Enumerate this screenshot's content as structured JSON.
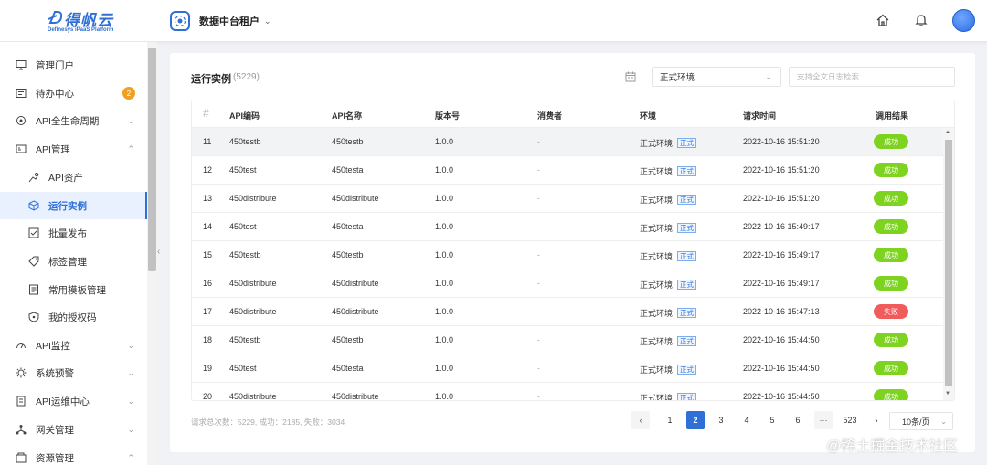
{
  "header": {
    "logo_text": "得帆云",
    "logo_sub": "Definesys iPaaS Platform",
    "tenant": "数据中台租户"
  },
  "sidebar": {
    "items": [
      {
        "label": "管理门户",
        "icon": "monitor-icon"
      },
      {
        "label": "待办中心",
        "icon": "todo-icon",
        "badge": "2"
      },
      {
        "label": "API全生命周期",
        "icon": "lifecycle-icon",
        "chevron": "down"
      },
      {
        "label": "API管理",
        "icon": "api-icon",
        "chevron": "up"
      },
      {
        "label": "API资产",
        "icon": "asset-icon",
        "sub": true
      },
      {
        "label": "运行实例",
        "icon": "cube-icon",
        "sub": true,
        "active": true
      },
      {
        "label": "批量发布",
        "icon": "batch-icon",
        "sub": true
      },
      {
        "label": "标签管理",
        "icon": "tag-icon",
        "sub": true
      },
      {
        "label": "常用模板管理",
        "icon": "template-icon",
        "sub": true
      },
      {
        "label": "我的授权码",
        "icon": "shield-icon",
        "sub": true
      },
      {
        "label": "API监控",
        "icon": "gauge-icon",
        "chevron": "down"
      },
      {
        "label": "系统预警",
        "icon": "alert-icon",
        "chevron": "down"
      },
      {
        "label": "API运维中心",
        "icon": "ops-icon",
        "chevron": "down"
      },
      {
        "label": "网关管理",
        "icon": "gateway-icon",
        "chevron": "down"
      },
      {
        "label": "资源管理",
        "icon": "resource-icon",
        "chevron": "up"
      }
    ]
  },
  "main": {
    "title": "运行实例",
    "count": "(5229)",
    "env_select": "正式环境",
    "search_placeholder": "支持全文日志检索"
  },
  "table": {
    "headers": {
      "hash": "#",
      "code": "API编码",
      "name": "API名称",
      "version": "版本号",
      "consumer": "消费者",
      "env": "环境",
      "time": "请求时间",
      "result": "调用结果"
    },
    "env_tag": "正式",
    "rows": [
      {
        "no": "11",
        "code": "450testb",
        "name": "450testb",
        "version": "1.0.0",
        "consumer": "-",
        "env": "正式环境",
        "time": "2022-10-16 15:51:20",
        "result": "成功",
        "ok": true
      },
      {
        "no": "12",
        "code": "450test",
        "name": "450testa",
        "version": "1.0.0",
        "consumer": "-",
        "env": "正式环境",
        "time": "2022-10-16 15:51:20",
        "result": "成功",
        "ok": true
      },
      {
        "no": "13",
        "code": "450distribute",
        "name": "450distribute",
        "version": "1.0.0",
        "consumer": "-",
        "env": "正式环境",
        "time": "2022-10-16 15:51:20",
        "result": "成功",
        "ok": true
      },
      {
        "no": "14",
        "code": "450test",
        "name": "450testa",
        "version": "1.0.0",
        "consumer": "-",
        "env": "正式环境",
        "time": "2022-10-16 15:49:17",
        "result": "成功",
        "ok": true
      },
      {
        "no": "15",
        "code": "450testb",
        "name": "450testb",
        "version": "1.0.0",
        "consumer": "-",
        "env": "正式环境",
        "time": "2022-10-16 15:49:17",
        "result": "成功",
        "ok": true
      },
      {
        "no": "16",
        "code": "450distribute",
        "name": "450distribute",
        "version": "1.0.0",
        "consumer": "-",
        "env": "正式环境",
        "time": "2022-10-16 15:49:17",
        "result": "成功",
        "ok": true
      },
      {
        "no": "17",
        "code": "450distribute",
        "name": "450distribute",
        "version": "1.0.0",
        "consumer": "-",
        "env": "正式环境",
        "time": "2022-10-16 15:47:13",
        "result": "失败",
        "ok": false
      },
      {
        "no": "18",
        "code": "450testb",
        "name": "450testb",
        "version": "1.0.0",
        "consumer": "-",
        "env": "正式环境",
        "time": "2022-10-16 15:44:50",
        "result": "成功",
        "ok": true
      },
      {
        "no": "19",
        "code": "450test",
        "name": "450testa",
        "version": "1.0.0",
        "consumer": "-",
        "env": "正式环境",
        "time": "2022-10-16 15:44:50",
        "result": "成功",
        "ok": true
      },
      {
        "no": "20",
        "code": "450distribute",
        "name": "450distribute",
        "version": "1.0.0",
        "consumer": "-",
        "env": "正式环境",
        "time": "2022-10-16 15:44:50",
        "result": "成功",
        "ok": true
      }
    ]
  },
  "summary": "请求总次数：5229,  成功：2185,  失败：3034",
  "pagination": {
    "pages": [
      "1",
      "2",
      "3",
      "4",
      "5",
      "6",
      "···",
      "523"
    ],
    "current": "2",
    "page_size": "10条/页"
  },
  "colors": {
    "primary": "#2f6fd6",
    "success": "#7ed321",
    "fail": "#f05b5b"
  },
  "watermark": "@稀土掘金技术社区"
}
